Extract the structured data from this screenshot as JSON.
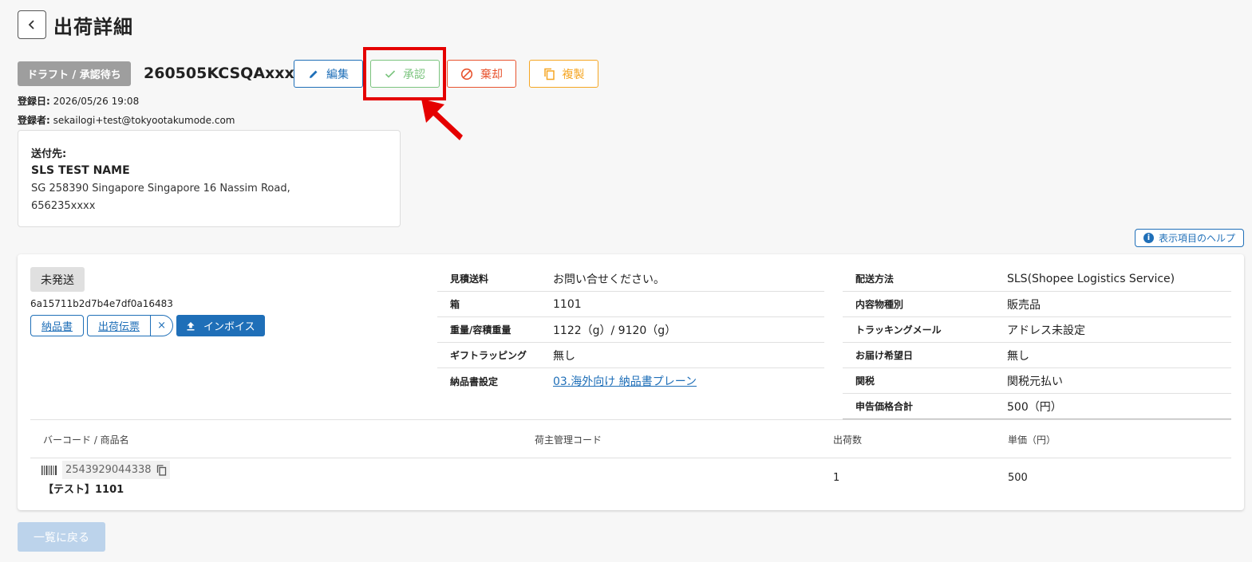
{
  "header": {
    "title": "出荷詳細",
    "back_icon": "chevron-left"
  },
  "status": "ドラフト / 承認待ち",
  "order_id": "260505KCSQAxxxx",
  "actions": {
    "edit": "編集",
    "approve": "承認",
    "discard": "棄却",
    "duplicate": "複製"
  },
  "colors": {
    "edit": "#1f6fb8",
    "approve": "#7bc47e",
    "discard": "#e8542f",
    "duplicate": "#f5a623",
    "highlight": "#e50000"
  },
  "meta": {
    "registered_label": "登録日:",
    "registered_value": "2026/05/26 19:08",
    "registrant_label": "登録者:",
    "registrant_value": "sekailogi+test@tokyootakumode.com"
  },
  "address": {
    "label": "送付先:",
    "name": "SLS TEST NAME",
    "line1": "SG 258390 Singapore Singapore 16 Nassim Road,",
    "line2": "656235xxxx"
  },
  "help_button": "表示項目のヘルプ",
  "shipment": {
    "status": "未発送",
    "hash": "6a15711b2d7b4e7df0a16483",
    "doc_delivery_note": "納品書",
    "doc_shipping_slip": "出荷伝票",
    "remove_symbol": "×",
    "invoice": "インボイス"
  },
  "info_mid": [
    {
      "key": "見積送料",
      "value": "お問い合せください。"
    },
    {
      "key": "箱",
      "value": "1101"
    },
    {
      "key": "重量/容積重量",
      "value": "1122（g）/ 9120（g）"
    },
    {
      "key": "ギフトラッピング",
      "value": "無し"
    },
    {
      "key": "納品書設定",
      "value": "03.海外向け 納品書プレーン"
    }
  ],
  "info_right": [
    {
      "key": "配送方法",
      "value": "SLS(Shopee Logistics Service)"
    },
    {
      "key": "内容物種別",
      "value": "販売品"
    },
    {
      "key": "トラッキングメール",
      "value": "アドレス未設定"
    },
    {
      "key": "お届け希望日",
      "value": "無し"
    },
    {
      "key": "関税",
      "value": "関税元払い"
    },
    {
      "key": "申告価格合計",
      "value": "500（円）"
    }
  ],
  "items_table": {
    "headers": [
      "バーコード / 商品名",
      "荷主管理コード",
      "出荷数",
      "単価（円）"
    ],
    "rows": [
      {
        "barcode": "2543929044338",
        "name": "【テスト】1101",
        "owner_code": "",
        "qty": "1",
        "price": "500"
      }
    ]
  },
  "back_to_list": "一覧に戻る"
}
